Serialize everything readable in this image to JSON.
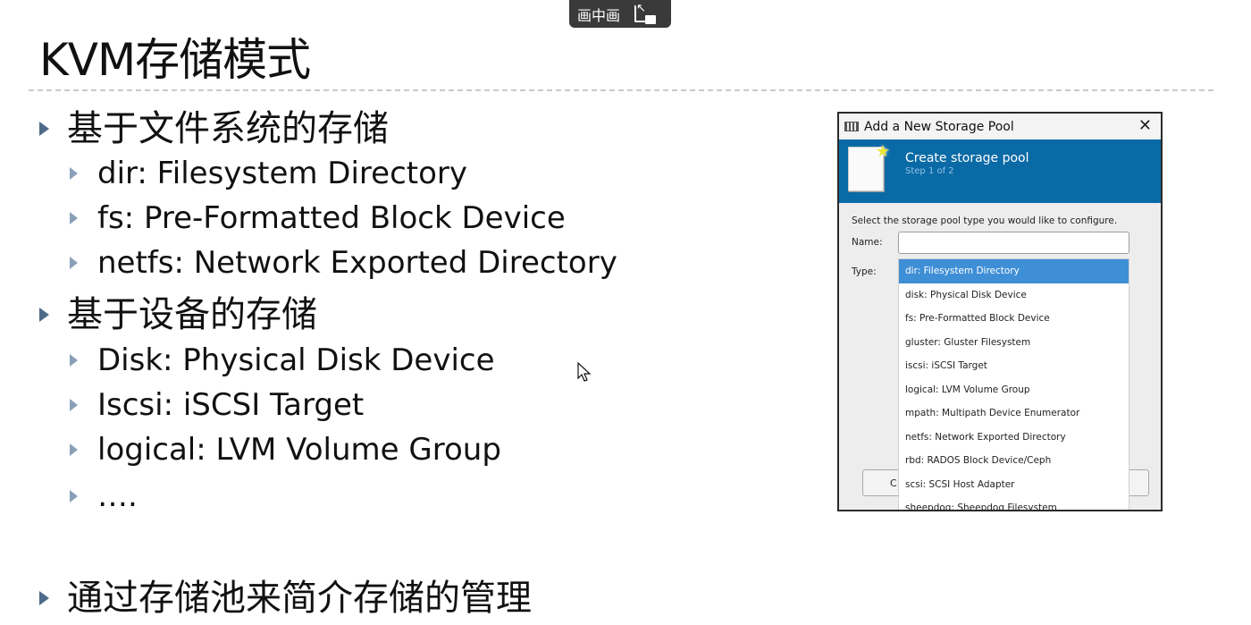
{
  "pip": {
    "label": "画中画"
  },
  "slide": {
    "title": "KVM存储模式",
    "sections": [
      {
        "heading": "基于文件系统的存储",
        "items": [
          "dir: Filesystem Directory",
          "fs: Pre-Formatted Block Device",
          "netfs: Network Exported Directory"
        ]
      },
      {
        "heading": "基于设备的存储",
        "items": [
          "Disk: Physical Disk Device",
          "Iscsi: iSCSI Target",
          "logical: LVM Volume Group",
          "…."
        ]
      },
      {
        "heading": "通过存储池来简介存储的管理",
        "items": []
      }
    ]
  },
  "dialog": {
    "window_title": "Add a New Storage Pool",
    "close_glyph": "✕",
    "header_title": "Create storage pool",
    "header_step": "Step 1 of 2",
    "prompt": "Select the storage pool type you would like to configure.",
    "name_label": "Name:",
    "type_label": "Type:",
    "name_value": "",
    "cancel_partial": "C",
    "dropdown_options": [
      "dir: Filesystem Directory",
      "disk: Physical Disk Device",
      "fs: Pre-Formatted Block Device",
      "gluster: Gluster Filesystem",
      "iscsi: iSCSI Target",
      "logical: LVM Volume Group",
      "mpath: Multipath Device Enumerator",
      "netfs: Network Exported Directory",
      "rbd: RADOS Block Device/Ceph",
      "scsi: SCSI Host Adapter",
      "sheepdog: Sheepdog Filesystem"
    ],
    "selected_option": "dir: Filesystem Directory"
  }
}
